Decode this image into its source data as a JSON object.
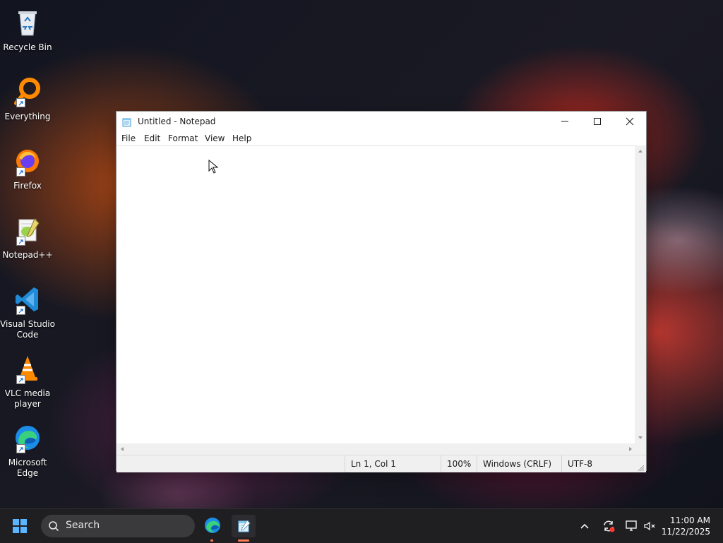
{
  "desktop": {
    "icons": [
      {
        "label": "Recycle Bin",
        "icon": "recycle-bin-icon"
      },
      {
        "label": "Everything",
        "icon": "everything-icon"
      },
      {
        "label": "Firefox",
        "icon": "firefox-icon"
      },
      {
        "label": "Notepad++",
        "icon": "notepad-plus-plus-icon"
      },
      {
        "label": "Visual Studio Code",
        "icon": "vscode-icon"
      },
      {
        "label": "VLC media player",
        "icon": "vlc-icon"
      },
      {
        "label": "Microsoft Edge",
        "icon": "edge-icon"
      }
    ]
  },
  "window": {
    "title": "Untitled - Notepad",
    "menu": {
      "file": "File",
      "edit": "Edit",
      "format": "Format",
      "view": "View",
      "help": "Help"
    },
    "status": {
      "position": "Ln 1, Col 1",
      "zoom": "100%",
      "line_endings": "Windows (CRLF)",
      "encoding": "UTF-8"
    }
  },
  "taskbar": {
    "search_label": "Search",
    "time": "11:00 AM",
    "date": "11/22/2025"
  },
  "colors": {
    "accent": "#ff7b55",
    "taskbar_bg": "#1f1f22",
    "window_bg": "#ffffff"
  }
}
